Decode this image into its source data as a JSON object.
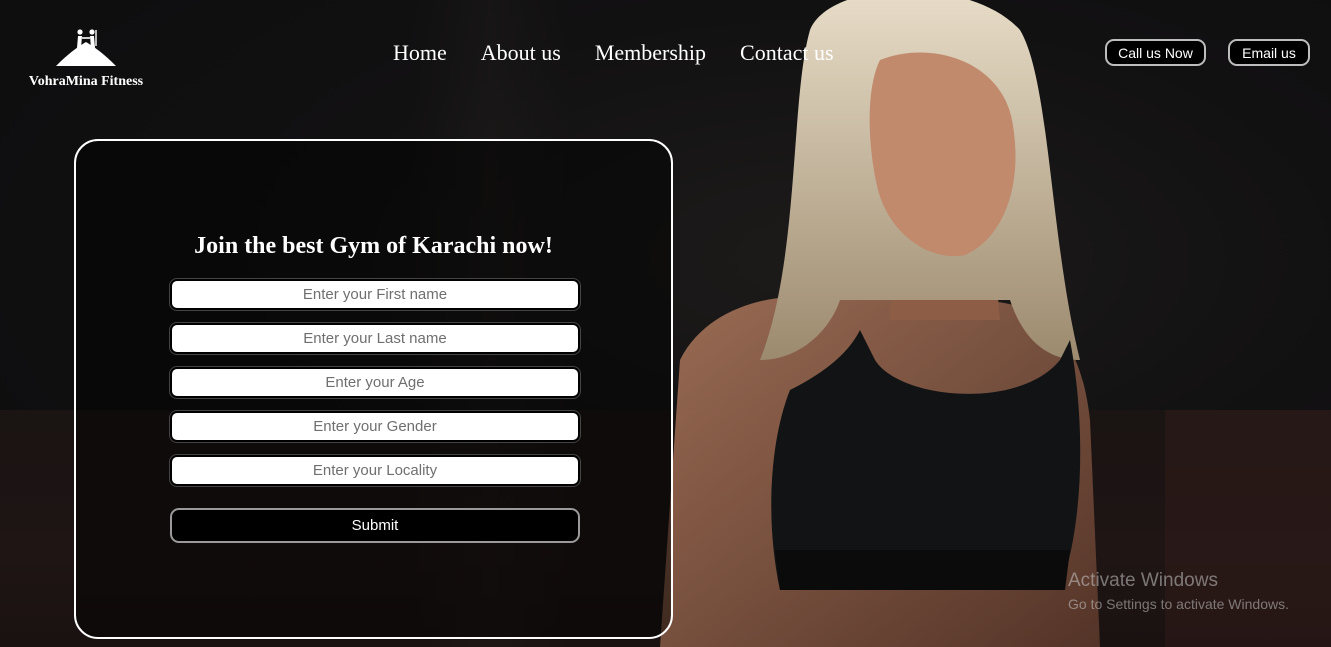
{
  "brand": {
    "name": "VohraMina Fitness",
    "logo_icon": "mountain-climbers-logo"
  },
  "nav": {
    "items": [
      {
        "label": "Home"
      },
      {
        "label": "About us"
      },
      {
        "label": "Membership"
      },
      {
        "label": "Contact us"
      }
    ]
  },
  "header_actions": {
    "call_label": "Call us Now",
    "email_label": "Email us"
  },
  "form": {
    "title": "Join the best Gym of Karachi now!",
    "fields": [
      {
        "placeholder": "Enter your First name",
        "value": ""
      },
      {
        "placeholder": "Enter your Last name",
        "value": ""
      },
      {
        "placeholder": "Enter your Age",
        "value": ""
      },
      {
        "placeholder": "Enter your Gender",
        "value": ""
      },
      {
        "placeholder": "Enter your Locality",
        "value": ""
      }
    ],
    "submit_label": "Submit"
  },
  "watermark": {
    "title": "Activate Windows",
    "subtitle": "Go to Settings to activate Windows."
  },
  "colors": {
    "background": "#0c0c0d",
    "text": "#ffffff",
    "button_bg": "#000000"
  }
}
